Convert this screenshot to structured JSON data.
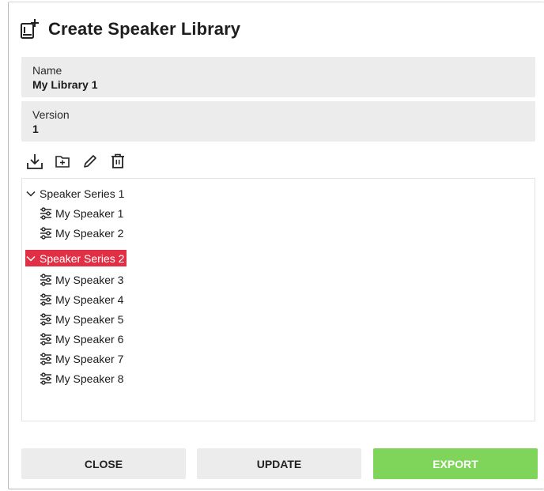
{
  "dialog": {
    "title": "Create Speaker Library",
    "title_icon": "new-library-icon"
  },
  "fields": {
    "name": {
      "label": "Name",
      "value": "My Library 1"
    },
    "version": {
      "label": "Version",
      "value": "1"
    }
  },
  "toolbar": {
    "icons": [
      "download-icon",
      "add-folder-icon",
      "edit-icon",
      "delete-icon"
    ]
  },
  "tree": {
    "series": [
      {
        "label": "Speaker Series 1",
        "expanded": true,
        "selected": false,
        "speakers": [
          "My Speaker 1",
          "My Speaker 2"
        ]
      },
      {
        "label": "Speaker Series 2",
        "expanded": true,
        "selected": true,
        "speakers": [
          "My Speaker 3",
          "My Speaker 4",
          "My Speaker 5",
          "My Speaker 6",
          "My Speaker 7",
          "My Speaker 8"
        ]
      }
    ],
    "selected_color": "#e13045"
  },
  "buttons": {
    "close": "CLOSE",
    "update": "UPDATE",
    "export": "EXPORT",
    "export_color": "#7fd45a"
  }
}
